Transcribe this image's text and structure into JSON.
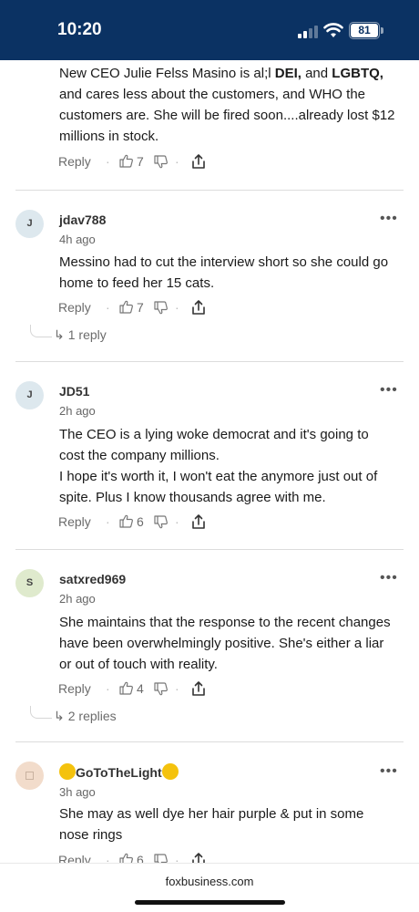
{
  "status_bar": {
    "time": "10:20",
    "battery": "81"
  },
  "top_comment": {
    "text_parts": [
      "New CEO  Julie Felss Masino  is al;l ",
      "DEI,",
      " and ",
      "LGBTQ,",
      " and cares less about the customers, and WHO the customers are.  She will be fired soon....already lost $12 millions in stock."
    ],
    "actions": {
      "reply": "Reply",
      "likes": "7"
    }
  },
  "comments": [
    {
      "avatar_letter": "J",
      "username": "jdav788",
      "time": "4h ago",
      "text": "Messino had to cut the interview short so she could go home to feed her 15 cats.",
      "reply": "Reply",
      "likes": "7",
      "replies": "1 reply"
    },
    {
      "avatar_letter": "J",
      "username": "JD51",
      "time": "2h ago",
      "text": "The CEO is a lying woke democrat and it's going to cost the company millions.",
      "text2": "I hope it's worth it, I won't eat the anymore just out of spite. Plus I know thousands agree with me.",
      "reply": "Reply",
      "likes": "6"
    },
    {
      "avatar_letter": "S",
      "username": "satxred969",
      "time": "2h ago",
      "text": "She maintains that the response to the recent changes have been overwhelmingly positive. She's either a liar or out of touch with reality.",
      "reply": "Reply",
      "likes": "4",
      "replies": "2 replies"
    },
    {
      "avatar_letter": "",
      "username": "GoToTheLight",
      "time": "3h ago",
      "text": "She may as well dye her hair purple & put in some nose rings",
      "reply": "Reply",
      "likes": "6"
    }
  ],
  "url_bar": {
    "domain": "foxbusiness.com"
  },
  "colors": {
    "status_bar": "#0b3263",
    "avatar_j": "#dde8ee",
    "avatar_s": "#dfeacd",
    "avatar_g": "#f2dccb"
  },
  "icons": [
    "thumbs-up-icon",
    "thumbs-down-icon",
    "share-icon",
    "more-icon",
    "reply-arrow-icon",
    "wifi-icon",
    "signal-icon",
    "battery-icon"
  ]
}
